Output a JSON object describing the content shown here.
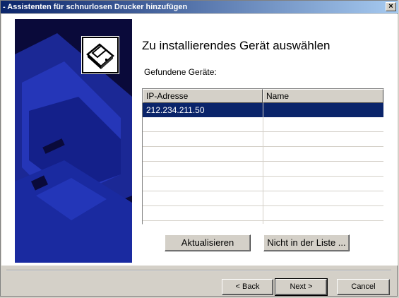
{
  "window": {
    "title": "- Assistenten für schnurlosen Drucker hinzufügen",
    "close_glyph": "×"
  },
  "header": {
    "title": "Zu installierendes Gerät auswählen",
    "found_label": "Gefundene Geräte:"
  },
  "device_list": {
    "columns": [
      "IP-Adresse",
      "Name"
    ],
    "rows": [
      {
        "ip": "212.234.211.50",
        "name": "",
        "selected": true
      }
    ],
    "empty_rows": 7
  },
  "actions": {
    "refresh_label": "Aktualisieren",
    "not_in_list_label": "Nicht in der Liste ..."
  },
  "nav": {
    "back_label": "< Back",
    "next_label": "Next >",
    "cancel_label": "Cancel"
  },
  "icons": {
    "wizard_icon": "printer-icon"
  },
  "colors": {
    "selection": "#0a246a",
    "panel": "#0a0a3a",
    "panel_art": "#1e2ea6",
    "face": "#d4d0c8"
  }
}
